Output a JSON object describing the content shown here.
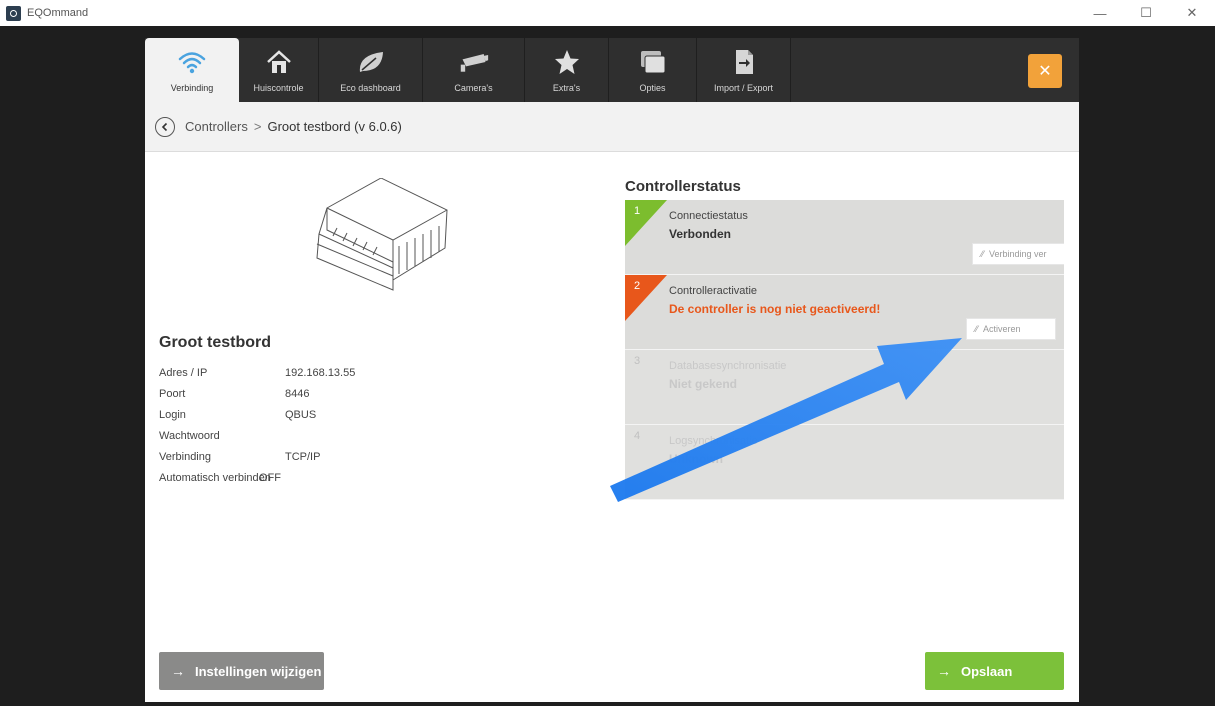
{
  "window": {
    "title": "EQOmmand",
    "controls": [
      "—",
      "☐",
      "✕"
    ]
  },
  "nav": {
    "tabs": [
      {
        "label": "Verbinding",
        "icon": "wifi-icon",
        "active": true
      },
      {
        "label": "Huiscontrole",
        "icon": "house-icon",
        "active": false
      },
      {
        "label": "Eco dashboard",
        "icon": "leaf-icon",
        "active": false
      },
      {
        "label": "Camera's",
        "icon": "camera-icon",
        "active": false
      },
      {
        "label": "Extra's",
        "icon": "star-icon",
        "active": false
      },
      {
        "label": "Opties",
        "icon": "windows-icon",
        "active": false
      },
      {
        "label": "Import / Export",
        "icon": "import-export-icon",
        "active": false
      }
    ],
    "close_glyph": "✕"
  },
  "breadcrumb": {
    "parent": "Controllers",
    "separator": ">",
    "current": "Groot testbord (v 6.0.6)"
  },
  "device": {
    "name": "Groot testbord",
    "properties": [
      {
        "key": "Adres / IP",
        "value": "192.168.13.55"
      },
      {
        "key": "Poort",
        "value": "8446"
      },
      {
        "key": "Login",
        "value": "QBUS"
      },
      {
        "key": "Wachtwoord",
        "value": ""
      },
      {
        "key": "Verbinding",
        "value": "TCP/IP"
      },
      {
        "key": "Automatisch verbinden",
        "value": "OFF"
      }
    ]
  },
  "status": {
    "title": "Controllerstatus",
    "steps": [
      {
        "num": "1",
        "label": "Connectiestatus",
        "value": "Verbonden",
        "button": "Verbinding ver",
        "state": "ok"
      },
      {
        "num": "2",
        "label": "Controlleractivatie",
        "value": "De controller is nog niet geactiveerd!",
        "button": "Activeren",
        "state": "error"
      },
      {
        "num": "3",
        "label": "Databasesynchronisatie",
        "value": "Niet gekend",
        "state": "pending"
      },
      {
        "num": "4",
        "label": "Logsynchronisatie",
        "value": "Unknown",
        "state": "pending"
      }
    ]
  },
  "buttons": {
    "settings": "Instellingen wijzigen",
    "save": "Opslaan",
    "arrow": "→"
  },
  "colors": {
    "ok": "#7cbd2e",
    "error": "#e8571b",
    "accent": "#f2a23a",
    "save": "#7cc13a",
    "annotation": "#1f7ff0"
  }
}
